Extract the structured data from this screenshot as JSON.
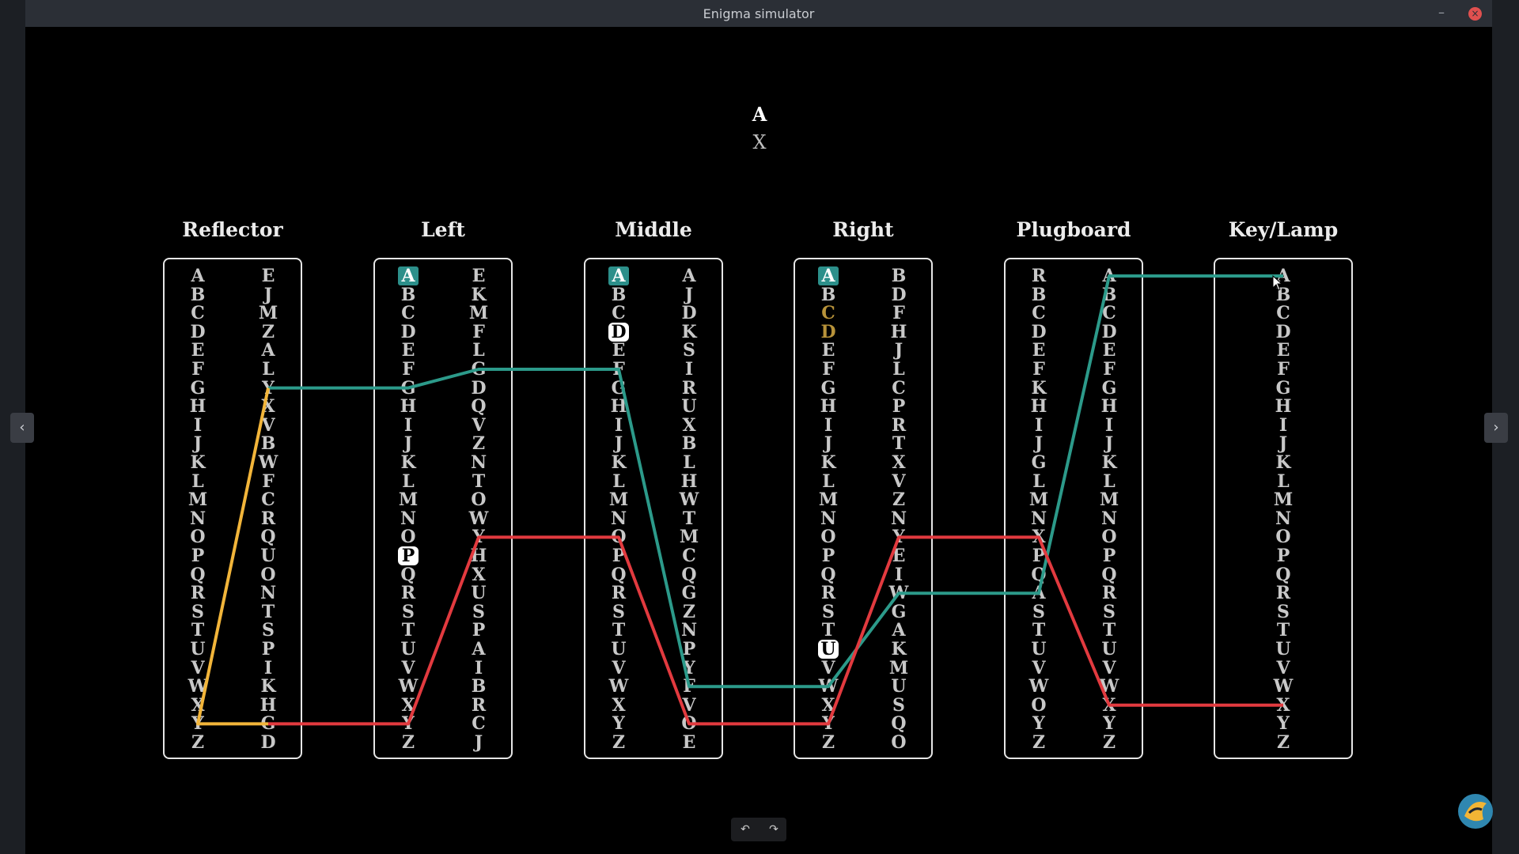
{
  "window": {
    "title": "Enigma simulator"
  },
  "display": {
    "input": "A",
    "output": "X"
  },
  "alphabet": [
    "A",
    "B",
    "C",
    "D",
    "E",
    "F",
    "G",
    "H",
    "I",
    "J",
    "K",
    "L",
    "M",
    "N",
    "O",
    "P",
    "Q",
    "R",
    "S",
    "T",
    "U",
    "V",
    "W",
    "X",
    "Y",
    "Z"
  ],
  "columns": [
    {
      "name": "Reflector",
      "key": "reflector",
      "inner": "ABCDEFGHIJKLMNOPQRSTUVWXYZ",
      "outer": "EJMZALYXVBWFCRQUONTSPIKHGD",
      "position_letter": null,
      "ring_letter": null
    },
    {
      "name": "Left",
      "key": "left",
      "inner": "ABCDEFGHIJKLMNOPQRSTUVWXYZ",
      "outer": "EKMFLGDQVZNTOWYHXUSPAIBRCJ",
      "position_letter": "A",
      "ring_letter": "P"
    },
    {
      "name": "Middle",
      "key": "middle",
      "inner": "ABCDEFGHIJKLMNOPQRSTUVWXYZ",
      "outer": "AJDKSIRUXBLHWTMCQGZNPYFVOE",
      "position_letter": "A",
      "ring_letter": "D"
    },
    {
      "name": "Right",
      "key": "right",
      "inner": "ABCDEFGHIJKLMNOPQRSTUVWXYZ",
      "outer": "BDFHJLCPRTXVZNYEIWGAKMUSQO",
      "position_letter": "A",
      "ring_letter": "U"
    },
    {
      "name": "Plugboard",
      "key": "plugboard",
      "inner": "RBCDEFKHIJGLMNXPQASTUVWOYZ",
      "outer": "ABCDEFGHIJKLMNOPQRSTUVWXYZ",
      "position_letter": null,
      "ring_letter": null
    },
    {
      "name": "Key/Lamp",
      "key": "keylamp",
      "inner": "ABCDEFGHIJKLMNOPQRSTUVWXYZ",
      "outer": null,
      "position_letter": null,
      "ring_letter": null
    }
  ],
  "controls": {
    "prev": "‹",
    "next": "›",
    "undo": "↶",
    "redo": "↷",
    "minimize": "–",
    "close": "×"
  },
  "colors": {
    "forward_path": "#2c9a8a",
    "return_path": "#e23a3f",
    "reflector_path": "#f2b53a",
    "highlight": "#2c8f8a"
  },
  "icons": {
    "logo": "enigma-logo-icon",
    "cursor": "mouse-cursor-icon"
  }
}
